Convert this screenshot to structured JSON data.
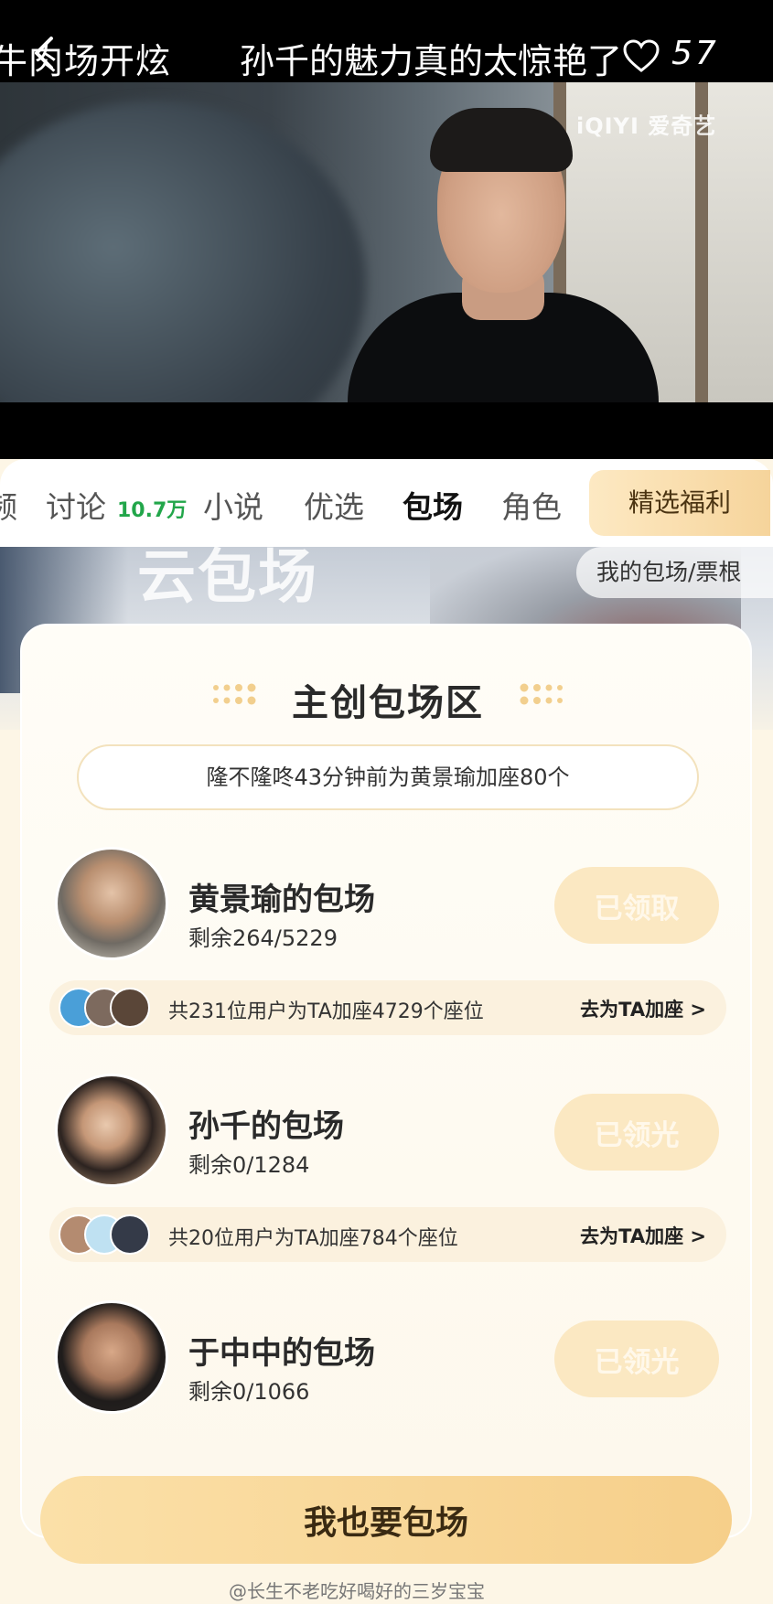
{
  "top_bar": {
    "marquee_left": "牛肉场开炫",
    "title": "孙千的魅力真的太惊艳了",
    "likes": "57"
  },
  "video": {
    "watermark": "iQIYI 爱奇艺"
  },
  "tabs": {
    "items": [
      {
        "label": "频"
      },
      {
        "label": "讨论"
      },
      {
        "label": "小说"
      },
      {
        "label": "优选"
      },
      {
        "label": "包场"
      },
      {
        "label": "角色"
      }
    ],
    "discussion_count": "10.7万",
    "active": "包场",
    "benefit": "精选福利"
  },
  "banner": {
    "text": "云包场",
    "ticket_link": "我的包场/票根"
  },
  "zone": {
    "title": "主创包场区",
    "notice": "隆不隆咚43分钟前为黄景瑜加座80个"
  },
  "rows": [
    {
      "name": "黄景瑜的包场",
      "remain": "剩余264/5229",
      "button": "已领取",
      "support_text": "共231位用户为TA加座4729个座位",
      "support_link": "去为TA加座 >"
    },
    {
      "name": "孙千的包场",
      "remain": "剩余0/1284",
      "button": "已领光",
      "support_text": "共20位用户为TA加座784个座位",
      "support_link": "去为TA加座 >"
    },
    {
      "name": "于中中的包场",
      "remain": "剩余0/1066",
      "button": "已领光"
    }
  ],
  "cta": "我也要包场",
  "credit": "@长生不老吃好喝好的三岁宝宝",
  "colors": {
    "accent_gold": "#f6cf8a",
    "button_disabled": "#fbe8c2",
    "count_green": "#22a64a"
  }
}
